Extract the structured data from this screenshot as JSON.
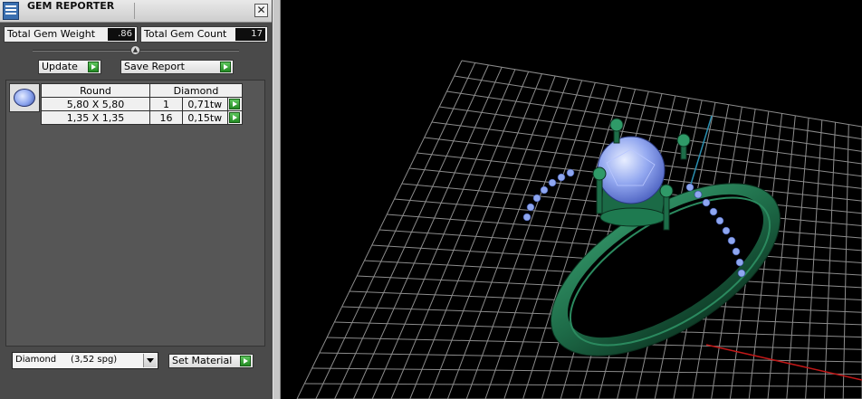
{
  "window": {
    "title": "GEM REPORTER",
    "close_glyph": "✕"
  },
  "stats": {
    "total_gem_weight_label": "Total Gem Weight",
    "total_gem_weight_value": ".86",
    "total_gem_count_label": "Total Gem Count",
    "total_gem_count_value": "17"
  },
  "toolbar": {
    "update_label": "Update",
    "save_report_label": "Save Report"
  },
  "gem_table": {
    "gem_icon": "round-gem-icon",
    "header": {
      "shape": "Round",
      "material": "Diamond"
    },
    "rows": [
      {
        "size": "5,80 X 5,80",
        "count": "1",
        "weight": "0,71tw"
      },
      {
        "size": "1,35 X 1,35",
        "count": "16",
        "weight": "0,15tw"
      }
    ]
  },
  "material_select": {
    "value": "Diamond     (3,52 spg)"
  },
  "set_material_label": "Set Material",
  "colors": {
    "panel": "#4a4a4a",
    "play_green": "#2ea52e",
    "ring_green": "#1f6b48",
    "gem_blue": "#8aa3ee",
    "grid": "#9a9a9a",
    "axis_blue": "#2a8fb0",
    "axis_red": "#c01818"
  }
}
